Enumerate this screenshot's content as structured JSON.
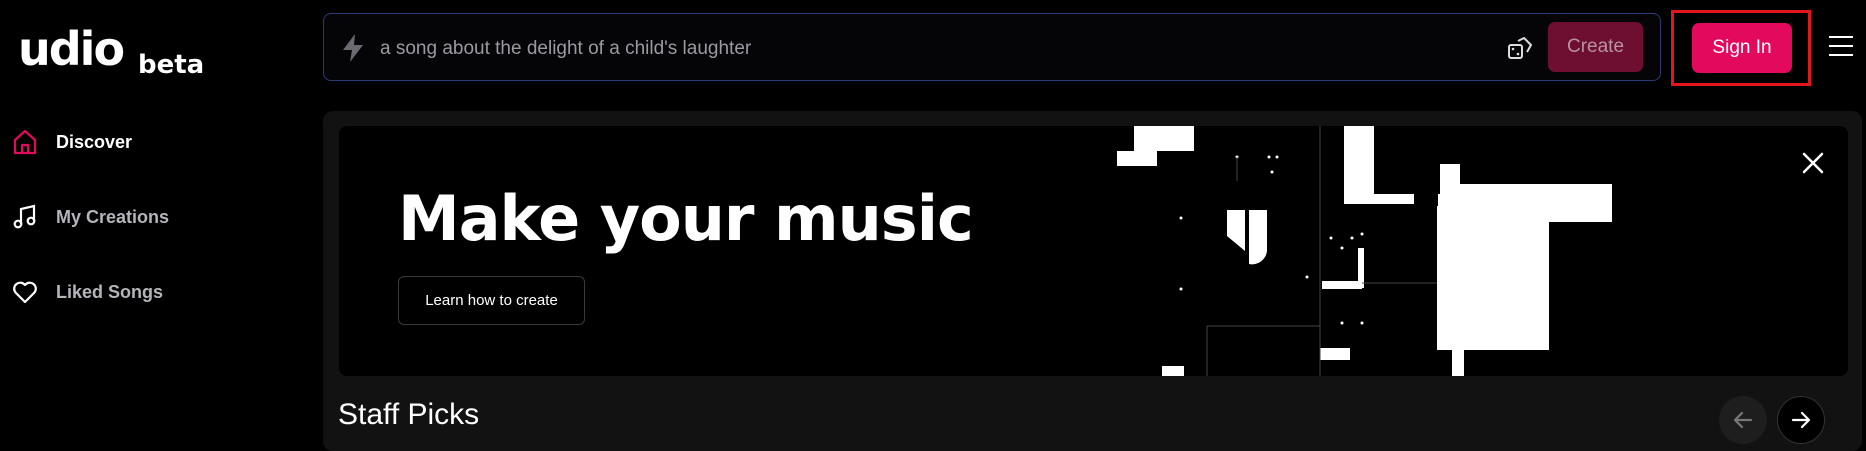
{
  "brand": {
    "logo": "udio",
    "tag": "beta"
  },
  "sidebar": {
    "items": [
      {
        "label": "Discover",
        "icon": "home-icon",
        "active": true
      },
      {
        "label": "My Creations",
        "icon": "music-note-icon",
        "active": false
      },
      {
        "label": "Liked Songs",
        "icon": "heart-icon",
        "active": false
      }
    ]
  },
  "topbar": {
    "prompt_placeholder": "a song about the delight of a child's laughter",
    "create_label": "Create",
    "signin_label": "Sign In"
  },
  "banner": {
    "title": "Make your music",
    "cta_label": "Learn how to create"
  },
  "section": {
    "title": "Staff Picks"
  },
  "colors": {
    "accent": "#e30a5e",
    "create_disabled": "#6e0e31",
    "highlight_outline": "#e2161e",
    "prompt_border": "#2c3a73"
  }
}
